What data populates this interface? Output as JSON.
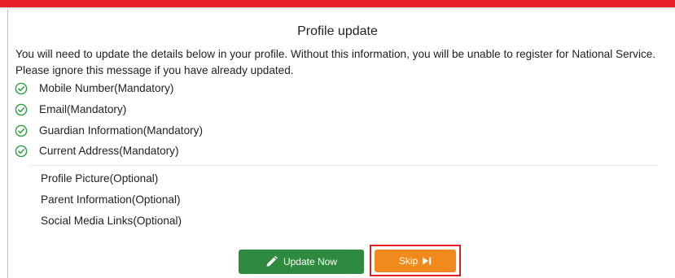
{
  "dialog": {
    "title": "Profile update",
    "intro": "You will need to update the details below in your profile. Without this information, you will be unable to register for National Service. Please ignore this message if you have already updated."
  },
  "mandatory_items": [
    {
      "label": "Mobile Number(Mandatory)",
      "icon": "check-circle-icon"
    },
    {
      "label": "Email(Mandatory)",
      "icon": "check-circle-icon"
    },
    {
      "label": "Guardian Information(Mandatory)",
      "icon": "check-circle-icon"
    },
    {
      "label": "Current Address(Mandatory)",
      "icon": "check-circle-icon"
    }
  ],
  "optional_items": [
    {
      "label": "Profile Picture(Optional)"
    },
    {
      "label": "Parent Information(Optional)"
    },
    {
      "label": "Social Media Links(Optional)"
    }
  ],
  "buttons": {
    "update_label": "Update Now",
    "update_icon": "pencil-icon",
    "skip_label": "Skip",
    "skip_icon": "skip-forward-icon"
  },
  "colors": {
    "top_bar": "#e8202a",
    "check": "#2d9b3f",
    "update_button": "#2d8a3e",
    "skip_button": "#f08a1c",
    "highlight": "#e02020"
  }
}
